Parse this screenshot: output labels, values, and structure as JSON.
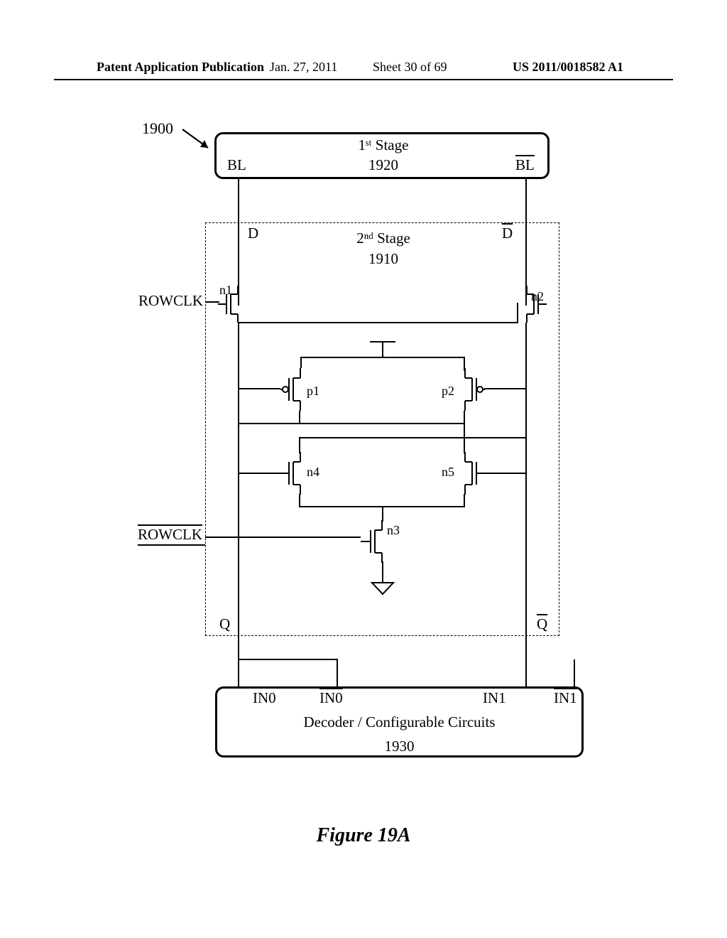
{
  "header": {
    "pub": "Patent Application Publication",
    "date": "Jan. 27, 2011",
    "sheet": "Sheet 30 of 69",
    "docnum": "US 2011/0018582 A1"
  },
  "refnum": "1900",
  "stage1": {
    "title_line1": "1ˢᵗ Stage",
    "title_line2": "1920",
    "bl": "BL",
    "blbar": "BL"
  },
  "stage2": {
    "title_line1": "2ⁿᵈ Stage",
    "title_line2": "1910",
    "d": "D",
    "dbar": "D",
    "q": "Q",
    "qbar": "Q",
    "rowclk": "ROWCLK",
    "rowclkbar": "ROWCLK",
    "n1": "n1",
    "n2": "n2",
    "n3": "n3",
    "n4": "n4",
    "n5": "n5",
    "p1": "p1",
    "p2": "p2"
  },
  "decoder": {
    "title_line1": "Decoder / Configurable Circuits",
    "title_line2": "1930",
    "in0": "IN0",
    "in0bar": "IN0",
    "in1": "IN1",
    "in1bar": "IN1"
  },
  "caption": "Figure 19A"
}
